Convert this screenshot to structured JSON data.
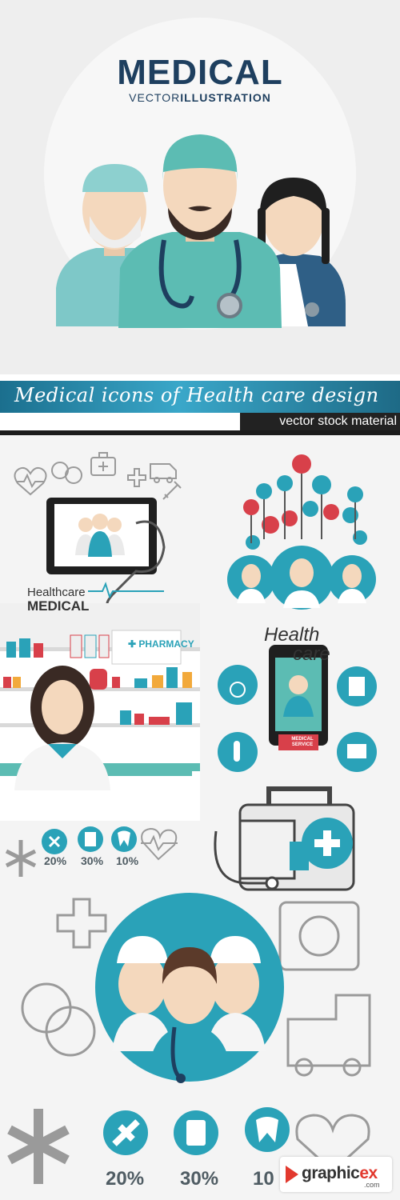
{
  "hero": {
    "title": "MEDICAL",
    "subtitle_prefix": "VECTOR",
    "subtitle_bold": "ILLUSTRATION"
  },
  "banner": {
    "title": "Medical icons of Health care design",
    "subtitle": "vector stock material"
  },
  "collage": {
    "healthcare_label": "Healthcare",
    "medical_label": "MEDICAL",
    "pharmacy_sign": "PHARMACY",
    "health_care_title_1": "Health",
    "health_care_title_2": "care",
    "phone_label": "MEDICAL SERVICE",
    "small_stats": [
      "20%",
      "30%",
      "10%"
    ],
    "big_stats": [
      "20%",
      "30%",
      "10"
    ]
  },
  "watermark": {
    "brand_main": "graphic",
    "brand_ex": "ex",
    "brand_tld": ".com"
  },
  "colors": {
    "teal": "#2aa2b8",
    "navy": "#1e3f5f",
    "mint": "#5cbcb3",
    "skin": "#f4d8bd",
    "grey_icon": "#9a9a9a"
  },
  "icons": [
    "heart-pulse-icon",
    "pill-icon",
    "first-aid-kit-icon",
    "ambulance-icon",
    "cross-icon",
    "syringe-icon",
    "stethoscope-icon",
    "tooth-icon",
    "wheelchair-icon",
    "test-tube-icon",
    "tablet-icon",
    "medicine-bottle-icon",
    "star-of-life-icon",
    "bandage-icon",
    "blood-bag-icon"
  ]
}
